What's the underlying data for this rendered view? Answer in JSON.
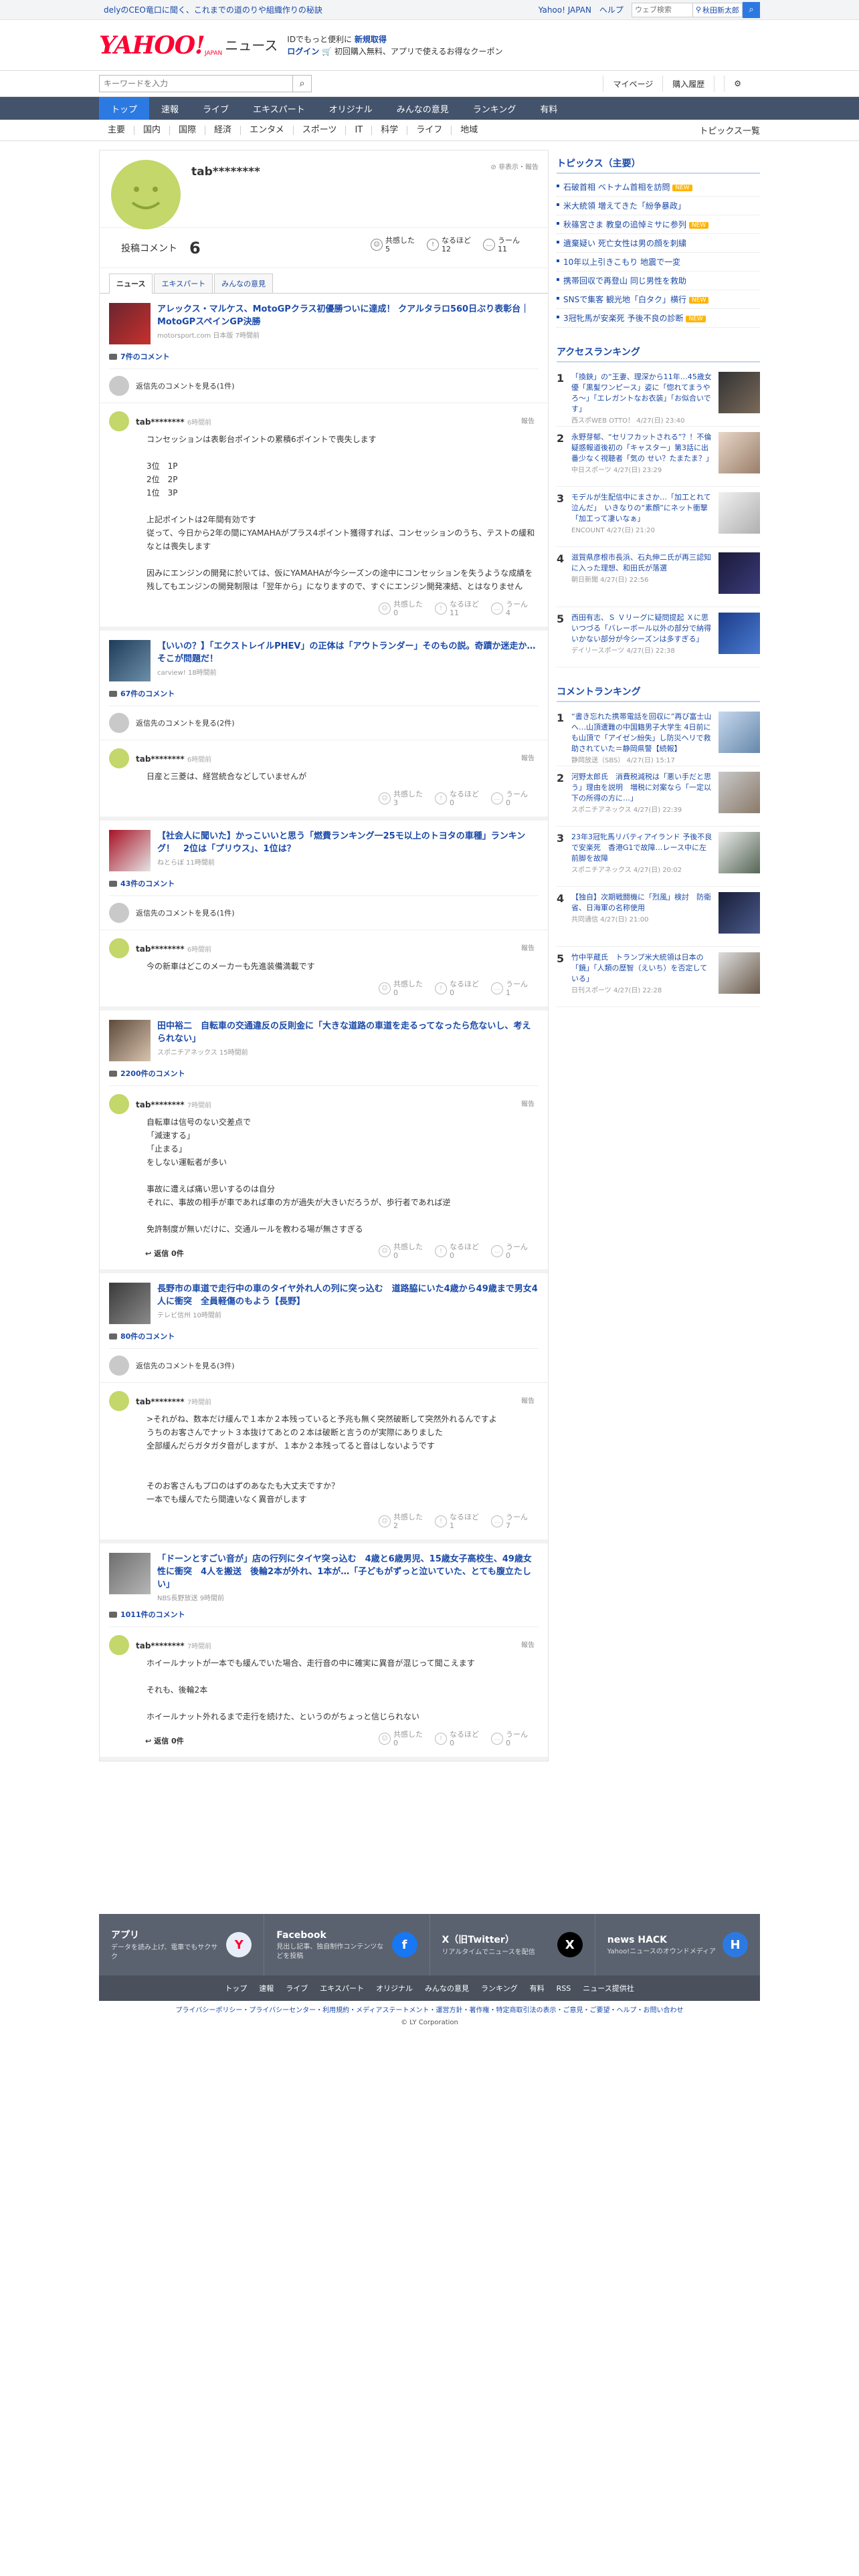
{
  "topbar": {
    "notice": "delyのCEO竜口に聞く、これまでの道のりや組織作りの秘訣",
    "links": [
      "Yahoo! JAPAN",
      "ヘルプ"
    ],
    "search_placeholder": "ウェブ検索",
    "location": "秋田新太郎"
  },
  "header": {
    "logo_text": "YAHOO!",
    "logo_sub": "JAPAN",
    "brand": "ニュース",
    "promo_line1": "IDでもっと便利に",
    "promo_link1": "新規取得",
    "promo_line2": "ログイン",
    "promo_line2b": "初回購入無料、アプリで使えるお得なクーポン"
  },
  "searchbar": {
    "placeholder": "キーワードを入力",
    "mypage": "マイページ",
    "history": "購入履歴"
  },
  "nav": [
    "トップ",
    "速報",
    "ライブ",
    "エキスパート",
    "オリジナル",
    "みんなの意見",
    "ランキング",
    "有料"
  ],
  "subnav": {
    "items": [
      "主要",
      "国内",
      "国際",
      "経済",
      "エンタメ",
      "スポーツ",
      "IT",
      "科学",
      "ライフ",
      "地域"
    ],
    "topics": "トピックス一覧"
  },
  "profile": {
    "username": "tab********",
    "hide": "非表示・報告",
    "comments_label": "投稿コメント",
    "comments_count": "6",
    "reactions": [
      {
        "icon": "☺",
        "label": "共感した",
        "count": "5"
      },
      {
        "icon": "!",
        "label": "なるほど",
        "count": "12"
      },
      {
        "icon": "…",
        "label": "うーん",
        "count": "11"
      }
    ],
    "tabs": [
      "ニュース",
      "エキスパート",
      "みんなの意見"
    ]
  },
  "cards": [
    {
      "title": "アレックス・マルケス、MotoGPクラス初優勝ついに達成！ クアルタラロ560日ぶり表彰台｜MotoGPスペインGP決勝",
      "source": "motorsport.com 日本版 7時間前",
      "count": "7件のコメント",
      "reply_more": "返信先のコメントを見る(1件)",
      "user": "tab********",
      "time": "6時間前",
      "report": "報告",
      "body": "コンセッションは表彰台ポイントの累積6ポイントで喪失します\n\n3位　1P\n2位　2P\n1位　3P\n\n上記ポイントは2年間有効です\n従って、今日から2年の間にYAMAHAがプラス4ポイント獲得すれば、コンセッションのうち、テストの緩和なとは喪失します\n\n因みにエンジンの開発に於いては、仮にYAMAHAが今シーズンの途中にコンセッションを失うような成績を残してもエンジンの開発制限は「翌年から」になりますので、すぐにエンジン開発凍結、とはなりません",
      "reactions": [
        {
          "label": "共感した",
          "count": "0"
        },
        {
          "label": "なるほど",
          "count": "11"
        },
        {
          "label": "うーん",
          "count": "4"
        }
      ],
      "reply": ""
    },
    {
      "title": "【いいの？】「エクストレイルPHEV」の正体は「アウトランダー」そのもの説。奇蹟か迷走か…そこが問題だ！",
      "source": "carview! 18時間前",
      "count": "67件のコメント",
      "reply_more": "返信先のコメントを見る(2件)",
      "user": "tab********",
      "time": "6時間前",
      "report": "報告",
      "body": "日産と三菱は、経営統合などしていませんが",
      "reactions": [
        {
          "label": "共感した",
          "count": "3"
        },
        {
          "label": "なるほど",
          "count": "0"
        },
        {
          "label": "うーん",
          "count": "0"
        }
      ],
      "reply": ""
    },
    {
      "title": "【社会人に聞いた】かっこいいと思う「燃費ランキング一25モ以上のトヨタの車種」ランキング！　2位は「プリウス」、1位は？",
      "source": "ねとらぼ 11時間前",
      "count": "43件のコメント",
      "reply_more": "返信先のコメントを見る(1件)",
      "user": "tab********",
      "time": "6時間前",
      "report": "報告",
      "body": "今の新車はどこのメーカーも先進装備満載です",
      "reactions": [
        {
          "label": "共感した",
          "count": "0"
        },
        {
          "label": "なるほど",
          "count": "0"
        },
        {
          "label": "うーん",
          "count": "1"
        }
      ],
      "reply": ""
    },
    {
      "title": "田中裕二　自転車の交通違反の反則金に「大きな道路の車道を走るってなったら危ないし、考えられない」",
      "source": "スポニチアネックス 15時間前",
      "count": "2200件のコメント",
      "reply_more": "",
      "user": "tab********",
      "time": "7時間前",
      "report": "報告",
      "body": "自転車は信号のない交差点で\n「減速する」\n「止まる」\nをしない運転者が多い\n\n事故に遭えば痛い思いするのは自分\nそれに、事故の相手が車であれば車の方が過失が大きいだろうが、歩行者であれば逆\n\n免許制度が無いだけに、交通ルールを教わる場が無さすぎる",
      "reactions": [
        {
          "label": "共感した",
          "count": "0"
        },
        {
          "label": "なるほど",
          "count": "0"
        },
        {
          "label": "うーん",
          "count": "0"
        }
      ],
      "reply": "返信 0件"
    },
    {
      "title": "長野市の車道で走行中の車のタイヤ外れ人の列に突っ込む　道路脇にいた4歳から49歳まで男女4人に衝突　全員軽傷のもよう【長野】",
      "source": "テレビ信州 10時間前",
      "count": "80件のコメント",
      "reply_more": "返信先のコメントを見る(3件)",
      "user": "tab********",
      "time": "7時間前",
      "report": "報告",
      "body": ">それがね、数本だけ緩んで１本か２本残っていると予兆も無く突然破断して突然外れるんですよ\nうちのお客さんでナット３本抜けてあとの２本は破断と言うのが実際にありました\n全部緩んだらガタガタ音がしますが、１本か２本残ってると音はしないようです\n\n\nそのお客さんもプロのはずのあなたも大丈夫ですか？\n一本でも緩んでたら間違いなく異音がします",
      "reactions": [
        {
          "label": "共感した",
          "count": "2"
        },
        {
          "label": "なるほど",
          "count": "1"
        },
        {
          "label": "うーん",
          "count": "7"
        }
      ],
      "reply": ""
    },
    {
      "title": "「ドーンとすごい音が」店の行列にタイヤ突っ込む　4歳と6歳男児、15歳女子高校生、49歳女性に衝突　4人を搬送　後輪2本が外れ、1本が…「子どもがずっと泣いていた、とても腹立たしい」",
      "source": "NBS長野放送 9時間前",
      "count": "1011件のコメント",
      "reply_more": "",
      "user": "tab********",
      "time": "7時間前",
      "report": "報告",
      "body": "ホイールナットが一本でも緩んでいた場合、走行音の中に確実に異音が混じって聞こえます\n\nそれも、後輪2本\n\nホイールナット外れるまで走行を続けた、というのがちょっと信じられない",
      "reactions": [
        {
          "label": "共感した",
          "count": "0"
        },
        {
          "label": "なるほど",
          "count": "0"
        },
        {
          "label": "うーん",
          "count": "0"
        }
      ],
      "reply": "返信 0件"
    }
  ],
  "sidebar": {
    "topics_title": "トピックス（主要）",
    "topics": [
      {
        "text": "石破首相 ベトナム首相を訪問",
        "badge": "NEW"
      },
      {
        "text": "米大統領 増えてきた「紛争暴政」",
        "badge": ""
      },
      {
        "text": "秋篠宮さま 教皇の追悼ミサに参列",
        "badge": "NEW"
      },
      {
        "text": "遺棄疑い 死亡女性は男の顔を刺繍",
        "badge": ""
      },
      {
        "text": "10年以上引きこもり 地震で一変",
        "badge": ""
      },
      {
        "text": "携帯回収で再登山 同じ男性を救助",
        "badge": ""
      },
      {
        "text": "SNSで集客 観光地「白タク」横行",
        "badge": "NEW"
      },
      {
        "text": "3冠牝馬が安楽死 予後不良の診断",
        "badge": "NEW"
      }
    ],
    "access_title": "アクセスランキング",
    "access": [
      {
        "no": "1",
        "text": "「換鋏」の“王妻、理深から11年…45歳女優「黒髪ワンピース」姿に「惚れてまうやろ〜」「エレガントなお衣装」「お似合いです」",
        "meta": "西スポWEB OTTO！ 4/27(日) 23:40"
      },
      {
        "no": "2",
        "text": "永野芽郁、“セリフカットされる”？！不倫疑惑報道後初の「キャスター」第3話に出番少なく視聴者「気の せい？たまたま？」",
        "meta": "中日スポーツ 4/27(日) 23:29"
      },
      {
        "no": "3",
        "text": "モデルが生配信中にまさか…「加工とれて泣んだ」　いきなりの“素顔”にネット衝撃「加工って凄いなぁ」",
        "meta": "ENCOUNT 4/27(日) 21:20"
      },
      {
        "no": "4",
        "text": "滋賀県彦根市長浜、石丸伸二氏が再三認知に入った理想、和田氏が落選",
        "meta": "朝日新聞 4/27(日) 22:56"
      },
      {
        "no": "5",
        "text": "西田有志、Ｓ Ｖリーグに疑問提起 Ｘに思いつづる「バレーボール以外の部分で納得いかない部分が今シーズンは多すぎる」",
        "meta": "デイリースポーツ 4/27(日) 22:38"
      }
    ],
    "comment_title": "コメントランキング",
    "comment_rank": [
      {
        "no": "1",
        "text": "“書き忘れた携帯電話を回収に”再び富士山へ…山頂遭難の中国籍男子大学生 4日前にも山頂で「アイゼン紛失」し防災ヘリで救助されていた＝静岡県警【続報】",
        "meta": "静岡放送（SBS） 4/27(日) 15:17"
      },
      {
        "no": "2",
        "text": "河野太郎氏　消費税減税は「悪い手だと思う」理由を説明　増税に対案なら「一定以下の所得の方に…」",
        "meta": "スポニチアネックス 4/27(日) 22:39"
      },
      {
        "no": "3",
        "text": "23年3冠牝馬リバティアイランド 予後不良で安楽死　香港G1で故障…レース中に左前脚を故障",
        "meta": "スポニチアネックス 4/27(日) 20:02"
      },
      {
        "no": "4",
        "text": "【独自】次期戦闘機に「烈風」検討　防衛省、日海軍の名称使用",
        "meta": "共同通信 4/27(日) 21:00"
      },
      {
        "no": "5",
        "text": "竹中平蔵氏　トランプ米大統領は日本の「鏡」「人類の歴智（えいち）を否定している」",
        "meta": "日刊スポーツ 4/27(日) 22:28"
      }
    ]
  },
  "footer": {
    "cells": [
      {
        "title": "アプリ",
        "desc": "データを読み上げ、電車でもサクサク",
        "icon": "Y"
      },
      {
        "title": "Facebook",
        "desc": "見出し記事、独自制作コンテンツなどを投稿",
        "icon": "f"
      },
      {
        "title": "X（旧Twitter）",
        "desc": "リアルタイムでニュースを配信",
        "icon": "X"
      },
      {
        "title": "news HACK",
        "desc": "Yahoo!ニュースのオウンドメディア",
        "icon": "H"
      }
    ],
    "links": [
      "トップ",
      "速報",
      "ライブ",
      "エキスパート",
      "オリジナル",
      "みんなの意見",
      "ランキング",
      "有料",
      "RSS",
      "ニュース提供社"
    ],
    "legal": "プライバシーポリシー・プライバシーセンター・利用規約・メディアステートメント・運営方針・著作権・特定商取引法の表示・ご意見・ご要望・ヘルプ・お問い合わせ",
    "copyright": "© LY Corporation"
  },
  "colors": {
    "accent": "#2c7ae1",
    "link": "#1b4aa8",
    "nav_bg": "#43536c",
    "brand": "#ff0033",
    "avatar": "#c3d76a"
  }
}
